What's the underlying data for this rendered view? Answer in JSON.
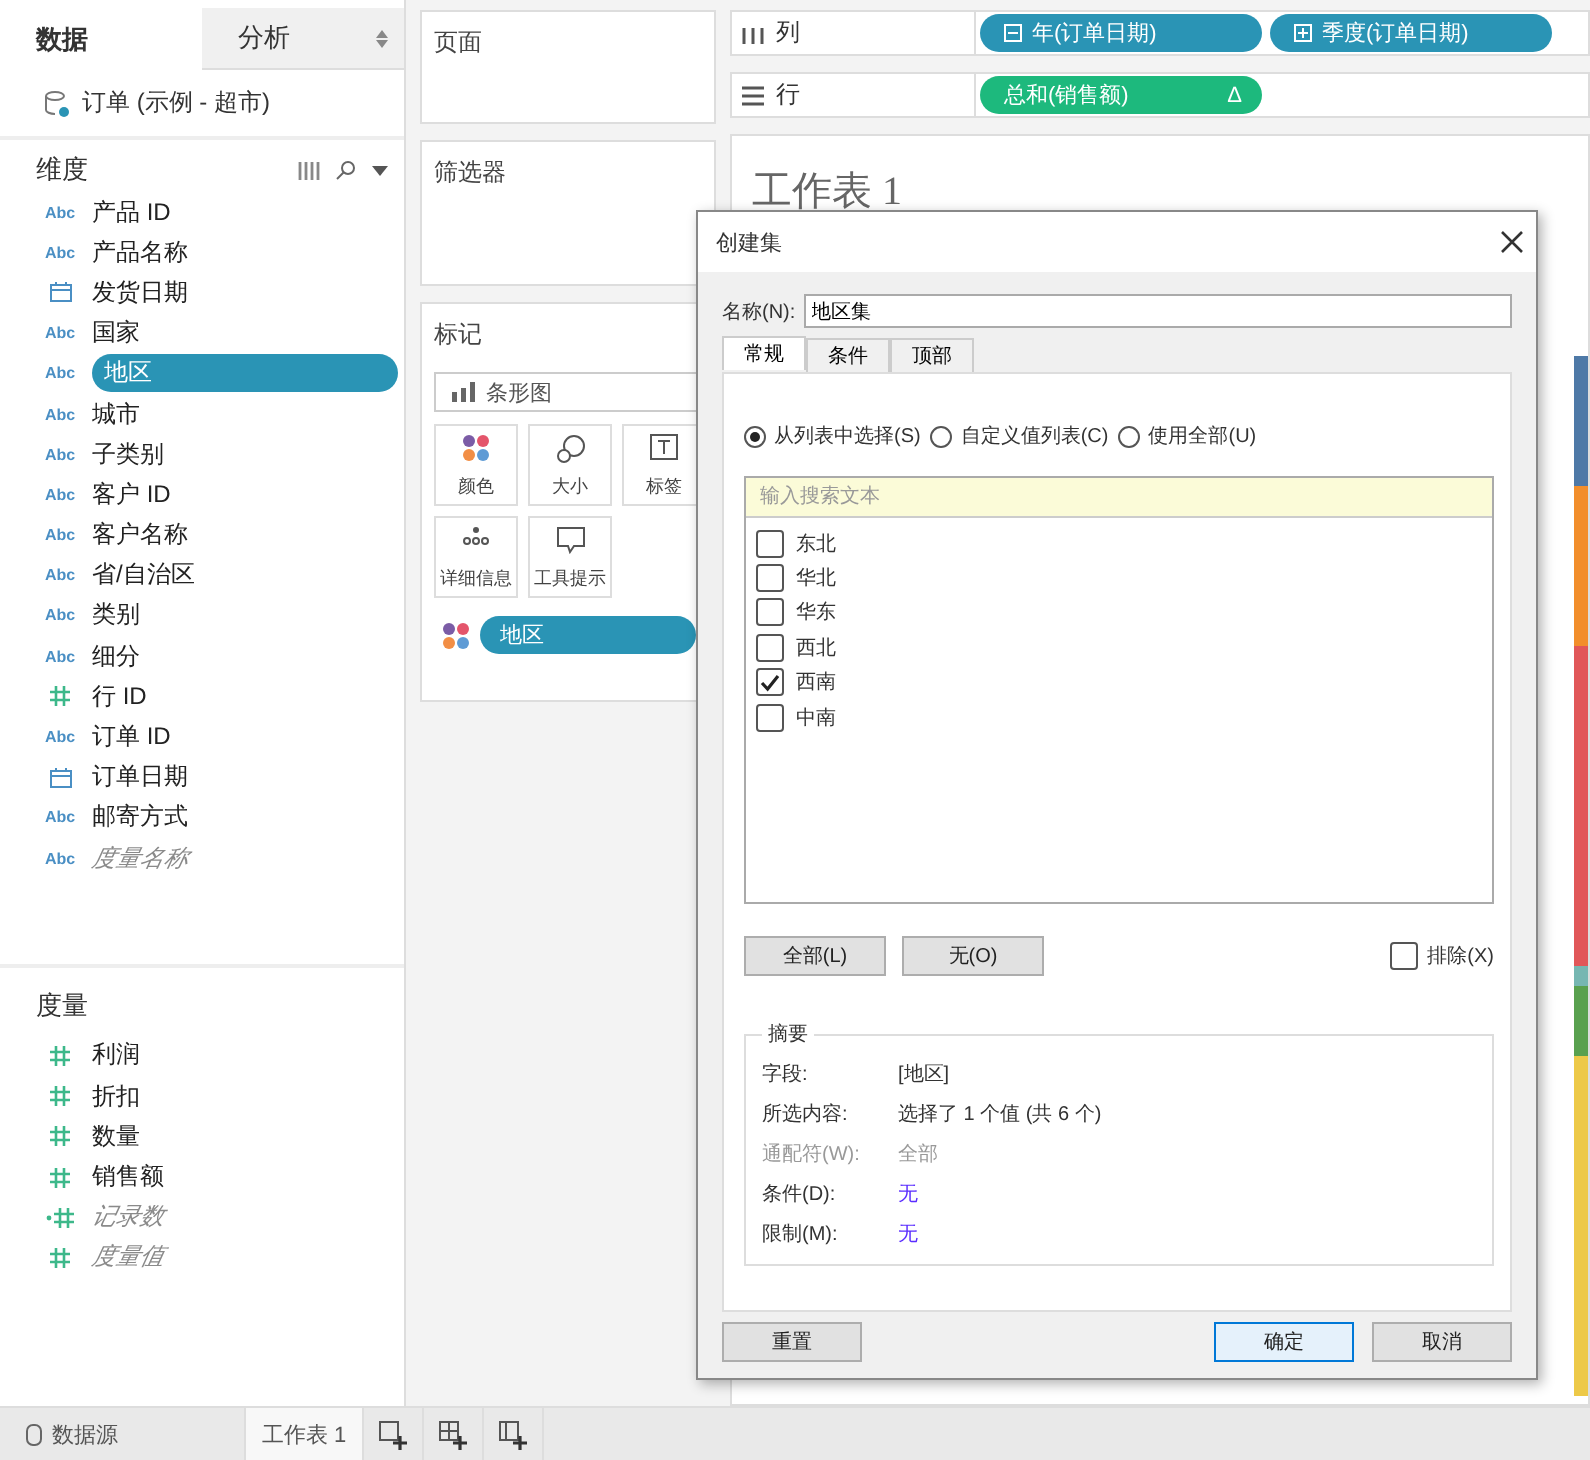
{
  "data_pane": {
    "tabs": [
      {
        "label": "数据",
        "selected": true
      },
      {
        "label": "分析",
        "selected": false
      }
    ],
    "data_source": "订单 (示例 - 超市)",
    "dimensions": {
      "title": "维度",
      "fields": [
        {
          "name": "产品 ID",
          "kind": "string",
          "icon": "Abc",
          "selected": false,
          "generated": false
        },
        {
          "name": "产品名称",
          "kind": "string",
          "icon": "Abc",
          "selected": false,
          "generated": false
        },
        {
          "name": "发货日期",
          "kind": "date",
          "selected": false,
          "generated": false
        },
        {
          "name": "国家",
          "kind": "string",
          "icon": "Abc",
          "selected": false,
          "generated": false
        },
        {
          "name": "地区",
          "kind": "string",
          "icon": "Abc",
          "selected": true,
          "generated": false
        },
        {
          "name": "城市",
          "kind": "string",
          "icon": "Abc",
          "selected": false,
          "generated": false
        },
        {
          "name": "子类别",
          "kind": "string",
          "icon": "Abc",
          "selected": false,
          "generated": false
        },
        {
          "name": "客户 ID",
          "kind": "string",
          "icon": "Abc",
          "selected": false,
          "generated": false
        },
        {
          "name": "客户名称",
          "kind": "string",
          "icon": "Abc",
          "selected": false,
          "generated": false
        },
        {
          "name": "省/自治区",
          "kind": "string",
          "icon": "Abc",
          "selected": false,
          "generated": false
        },
        {
          "name": "类别",
          "kind": "string",
          "icon": "Abc",
          "selected": false,
          "generated": false
        },
        {
          "name": "细分",
          "kind": "string",
          "icon": "Abc",
          "selected": false,
          "generated": false
        },
        {
          "name": "行 ID",
          "kind": "number",
          "selected": false,
          "generated": false
        },
        {
          "name": "订单 ID",
          "kind": "string",
          "icon": "Abc",
          "selected": false,
          "generated": false
        },
        {
          "name": "订单日期",
          "kind": "date",
          "selected": false,
          "generated": false
        },
        {
          "name": "邮寄方式",
          "kind": "string",
          "icon": "Abc",
          "selected": false,
          "generated": false
        },
        {
          "name": "度量名称",
          "kind": "string",
          "icon": "Abc",
          "selected": false,
          "generated": true
        }
      ]
    },
    "measures": {
      "title": "度量",
      "fields": [
        {
          "name": "利润",
          "kind": "number",
          "selected": false,
          "generated": false
        },
        {
          "name": "折扣",
          "kind": "number",
          "selected": false,
          "generated": false
        },
        {
          "name": "数量",
          "kind": "number",
          "selected": false,
          "generated": false
        },
        {
          "name": "销售额",
          "kind": "number",
          "selected": false,
          "generated": false
        },
        {
          "name": "记录数",
          "kind": "calculated",
          "selected": false,
          "generated": true
        },
        {
          "name": "度量值",
          "kind": "number",
          "selected": false,
          "generated": true
        }
      ]
    }
  },
  "pages_card": {
    "title": "页面"
  },
  "filters_card": {
    "title": "筛选器"
  },
  "marks_card": {
    "title": "标记",
    "mark_type": "条形图",
    "buttons": [
      {
        "label": "颜色",
        "kind": "color"
      },
      {
        "label": "大小",
        "kind": "size"
      },
      {
        "label": "标签",
        "kind": "label"
      },
      {
        "label": "详细信息",
        "kind": "detail"
      },
      {
        "label": "工具提示",
        "kind": "tooltip"
      }
    ],
    "pills": [
      {
        "label": "地区",
        "kind": "color"
      }
    ]
  },
  "columns_shelf": {
    "label": "列",
    "pills": [
      {
        "label": "年(订单日期)",
        "kind": "dimension",
        "expanded": true
      },
      {
        "label": "季度(订单日期)",
        "kind": "dimension",
        "expanded": false
      }
    ]
  },
  "rows_shelf": {
    "label": "行",
    "pills": [
      {
        "label": "总和(销售额)",
        "kind": "measure",
        "badge": "Δ"
      }
    ]
  },
  "worksheet": {
    "title": "工作表 1"
  },
  "dialog": {
    "title": "创建集",
    "name_label": "名称(N):",
    "name_value": "地区集",
    "tabs": [
      {
        "label": "常规",
        "selected": true
      },
      {
        "label": "条件",
        "selected": false
      },
      {
        "label": "顶部",
        "selected": false
      }
    ],
    "radios": [
      {
        "label": "从列表中选择(S)",
        "selected": true
      },
      {
        "label": "自定义值列表(C)",
        "selected": false
      },
      {
        "label": "使用全部(U)",
        "selected": false
      }
    ],
    "search": {
      "placeholder": "输入搜索文本"
    },
    "items": [
      {
        "label": "东北",
        "checked": false
      },
      {
        "label": "华北",
        "checked": false
      },
      {
        "label": "华东",
        "checked": false
      },
      {
        "label": "西北",
        "checked": false
      },
      {
        "label": "西南",
        "checked": true
      },
      {
        "label": "中南",
        "checked": false
      }
    ],
    "list_buttons": [
      "全部(L)",
      "无(O)"
    ],
    "exclude": {
      "label": "排除(X)",
      "checked": false
    },
    "summary": {
      "title": "摘要",
      "rows": [
        {
          "label": "字段:",
          "value": "[地区]",
          "kind": "normal"
        },
        {
          "label": "所选内容:",
          "value": "选择了 1 个值 (共 6 个)",
          "kind": "normal"
        },
        {
          "label": "通配符(W):",
          "value": "全部",
          "kind": "disabled"
        },
        {
          "label": "条件(D):",
          "value": "无",
          "kind": "link"
        },
        {
          "label": "限制(M):",
          "value": "无",
          "kind": "link"
        }
      ]
    },
    "footer_buttons": [
      {
        "label": "重置",
        "default": false
      },
      {
        "label": "确定",
        "default": true
      },
      {
        "label": "取消",
        "default": false
      }
    ]
  },
  "bottom_bar": {
    "data_source_tab": "数据源",
    "sheets": [
      {
        "label": "工作表 1",
        "selected": true
      }
    ]
  }
}
